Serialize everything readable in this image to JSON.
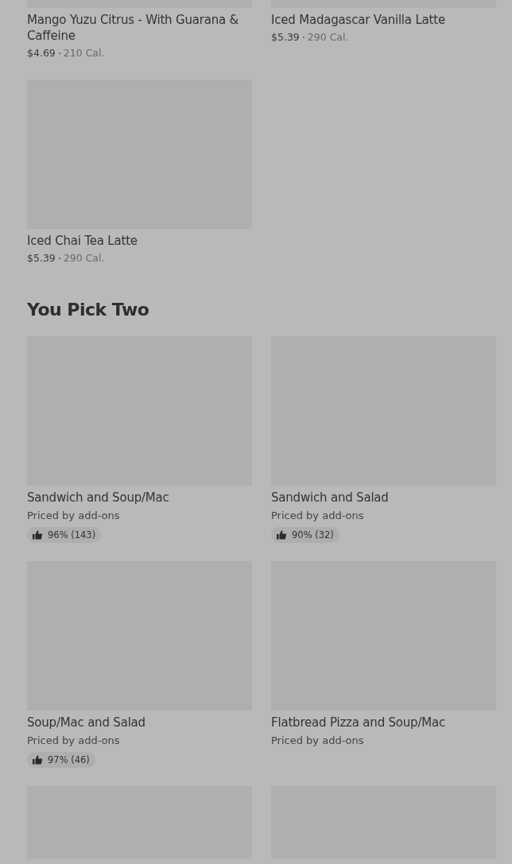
{
  "sections": [
    {
      "items": [
        {
          "name": "Mango Yuzu Citrus - With Guarana & Caffeine",
          "price": "$4.69",
          "calories": "210 Cal."
        },
        {
          "name": "Iced Madagascar Vanilla Latte",
          "price": "$5.39",
          "calories": "290 Cal."
        },
        {
          "name": "Iced Chai Tea Latte",
          "price": "$5.39",
          "calories": "290 Cal."
        }
      ]
    },
    {
      "heading": "You Pick Two",
      "items": [
        {
          "name": "Sandwich and Soup/Mac",
          "price_note": "Priced by add-ons",
          "rating": "96% (143)"
        },
        {
          "name": "Sandwich and Salad",
          "price_note": "Priced by add-ons",
          "rating": "90% (32)"
        },
        {
          "name": "Soup/Mac and Salad",
          "price_note": "Priced by add-ons",
          "rating": "97% (46)"
        },
        {
          "name": "Flatbread Pizza and Soup/Mac",
          "price_note": "Priced by add-ons"
        },
        {
          "kind": "picture"
        },
        {
          "kind": "picture"
        }
      ]
    }
  ]
}
